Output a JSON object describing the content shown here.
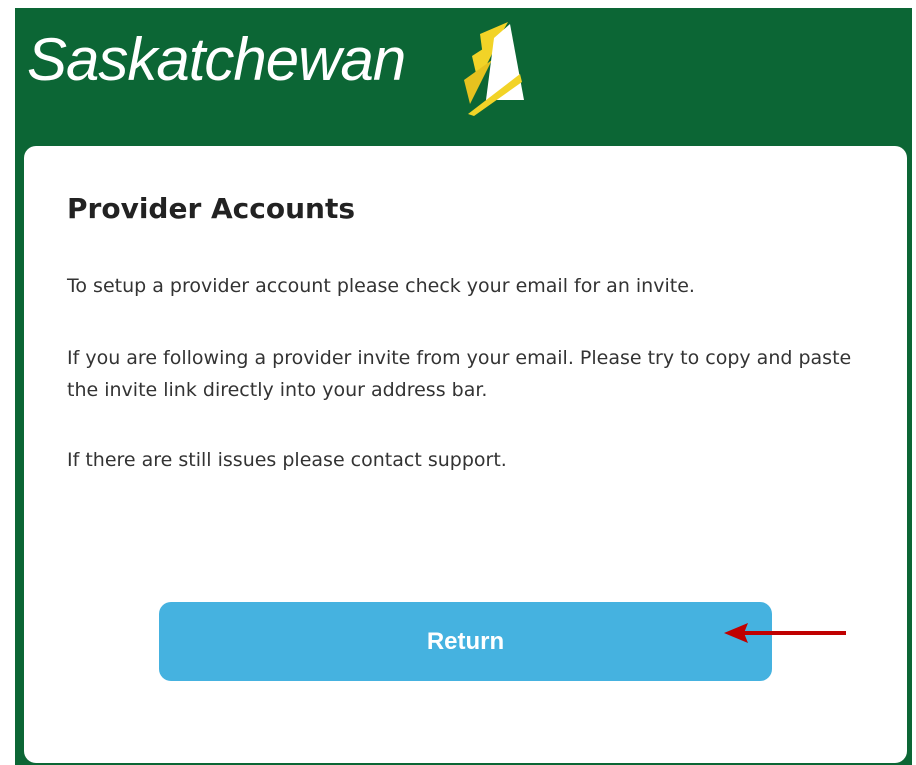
{
  "header": {
    "logo_text": "Saskatchewan",
    "logo_icon": "wheat-sheaf-icon",
    "background_color": "#0c6635"
  },
  "card": {
    "title": "Provider Accounts",
    "paragraphs": [
      "To setup a provider account please check your email for an invite.",
      "If you are following a provider invite from your email. Please try to copy and paste the invite link directly into your address bar.",
      "If there are still issues please contact support."
    ],
    "return_label": "Return",
    "button_color": "#45b2e0"
  },
  "annotation": {
    "icon": "arrow-left-icon",
    "color": "#c00000"
  }
}
